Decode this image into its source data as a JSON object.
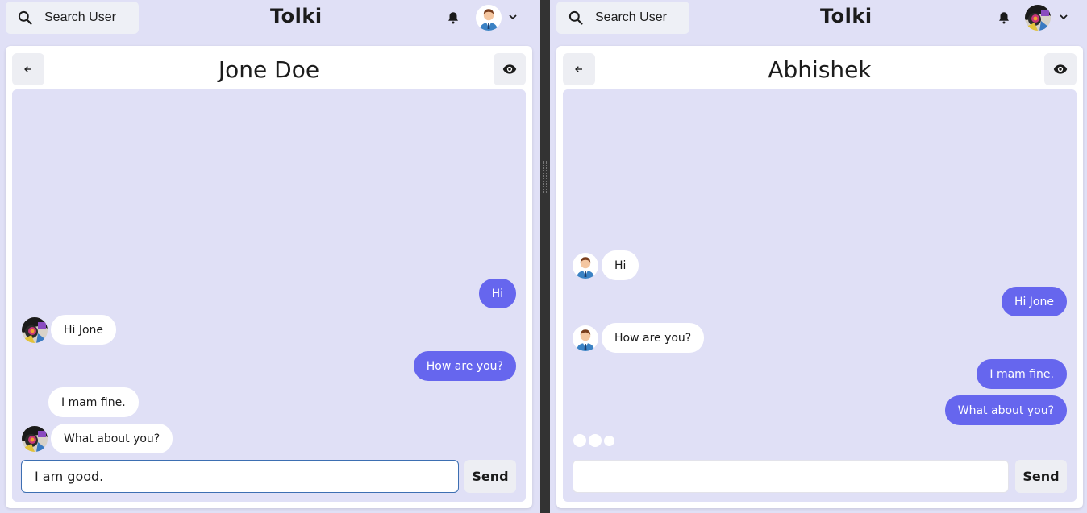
{
  "colors": {
    "accent": "#6666ee",
    "background": "#e0e0f6",
    "card": "#ffffff"
  },
  "left": {
    "search_label": "Search User",
    "brand": "Tolki",
    "chat_title": "Jone Doe",
    "input_prefix": "I am ",
    "input_misspelled": "good",
    "input_suffix": ".",
    "send_label": "Send",
    "messages": [
      {
        "side": "out",
        "text": "Hi"
      },
      {
        "side": "in",
        "text": "Hi Jone"
      },
      {
        "side": "out",
        "text": "How are you?"
      },
      {
        "side": "in",
        "text": "I mam fine."
      },
      {
        "side": "in",
        "text": "What about you?"
      }
    ]
  },
  "right": {
    "search_label": "Search User",
    "brand": "Tolki",
    "chat_title": "Abhishek",
    "input_value": "",
    "send_label": "Send",
    "messages": [
      {
        "side": "in",
        "text": "Hi"
      },
      {
        "side": "out",
        "text": "Hi Jone"
      },
      {
        "side": "in",
        "text": "How are you?"
      },
      {
        "side": "out",
        "text": "I mam fine."
      },
      {
        "side": "out",
        "text": "What about you?"
      }
    ],
    "typing_indicator": true
  },
  "icons": {
    "search": "search-icon",
    "bell": "bell-icon",
    "back": "arrow-left-icon",
    "view": "eye-icon",
    "chevron": "chevron-down-icon"
  }
}
